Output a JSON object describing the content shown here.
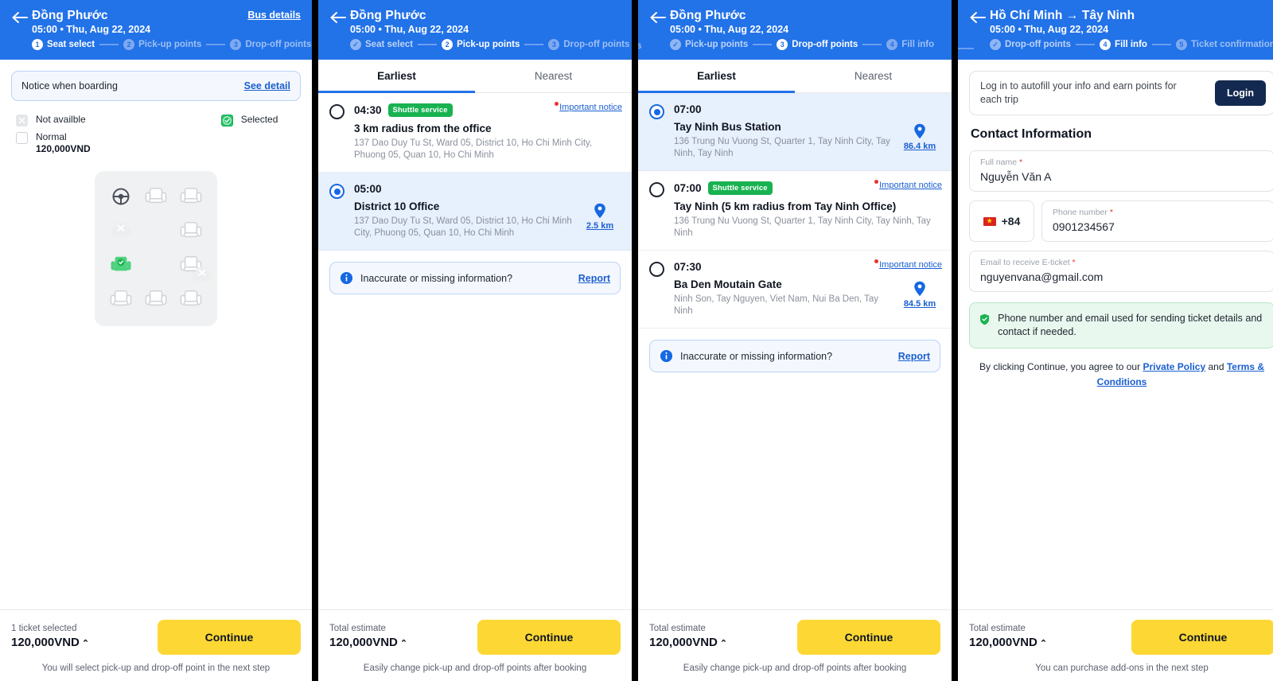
{
  "colors": {
    "header_blue": "#2272e8",
    "accent_yellow": "#fdd835",
    "link_blue": "#1a5fd0",
    "green": "#19b251",
    "selected_row": "#e7f0fd",
    "navy": "#13294f"
  },
  "panel1": {
    "header": {
      "title": "Đồng Phước",
      "subtitle": "05:00 • Thu, Aug 22, 2024",
      "right_link": "Bus details",
      "steps": [
        {
          "num": "1",
          "label": "Seat select",
          "state": "active"
        },
        {
          "num": "2",
          "label": "Pick-up points",
          "state": "todo"
        },
        {
          "num": "3",
          "label": "Drop-off points",
          "state": "todo"
        }
      ]
    },
    "notice": {
      "text": "Notice when boarding",
      "link": "See detail"
    },
    "legend": [
      {
        "key": "not_available",
        "label": "Not availble",
        "price": ""
      },
      {
        "key": "selected",
        "label": "Selected",
        "price": ""
      },
      {
        "key": "normal",
        "label": "Normal",
        "price": "120,000VND"
      }
    ],
    "seatmap": {
      "rows": [
        [
          "steering",
          "seat",
          "seat",
          "unavailable"
        ],
        [
          "unavailable",
          "empty",
          "seat",
          "empty"
        ],
        [
          "selected",
          "empty",
          "seat",
          "empty"
        ],
        [
          "seat",
          "seat",
          "seat",
          "empty"
        ]
      ]
    },
    "footer": {
      "label": "1 ticket selected",
      "price": "120,000VND",
      "caret": "⌃",
      "button": "Continue",
      "note": "You will select pick-up and drop-off point in the next step"
    }
  },
  "panel2": {
    "header": {
      "title": "Đồng Phước",
      "subtitle": "05:00 • Thu, Aug 22, 2024",
      "steps": [
        {
          "num": "✓",
          "label": "Seat select",
          "state": "done"
        },
        {
          "num": "2",
          "label": "Pick-up points",
          "state": "active"
        },
        {
          "num": "3",
          "label": "Drop-off points",
          "state": "todo"
        }
      ]
    },
    "tabs": [
      {
        "label": "Earliest",
        "active": true
      },
      {
        "label": "Nearest",
        "active": false
      }
    ],
    "points": [
      {
        "time": "04:30",
        "badge": "Shuttle service",
        "name": "3 km radius from the office",
        "address": "137 Dao Duy Tu St, Ward 05, District 10, Ho Chi Minh City, Phuong 05, Quan 10, Ho Chi Minh",
        "notice": "Important notice",
        "distance": "",
        "selected": false
      },
      {
        "time": "05:00",
        "badge": "",
        "name": "District 10 Office",
        "address": "137 Dao Duy Tu St, Ward 05, District 10, Ho Chi Minh City, Phuong 05, Quan 10, Ho Chi Minh",
        "notice": "",
        "distance": "2.5 km",
        "selected": true
      }
    ],
    "report": {
      "text": "Inaccurate or missing information?",
      "link": "Report"
    },
    "footer": {
      "label": "Total estimate",
      "price": "120,000VND",
      "caret": "⌃",
      "button": "Continue",
      "note": "Easily change pick-up and drop-off points after booking"
    }
  },
  "panel3": {
    "header": {
      "title": "Đồng Phước",
      "subtitle": "05:00 • Thu, Aug 22, 2024",
      "overflow_fragment": "s",
      "steps": [
        {
          "num": "✓",
          "label": "Pick-up points",
          "state": "done"
        },
        {
          "num": "3",
          "label": "Drop-off points",
          "state": "active"
        },
        {
          "num": "4",
          "label": "Fill info",
          "state": "todo"
        }
      ]
    },
    "tabs": [
      {
        "label": "Earliest",
        "active": true
      },
      {
        "label": "Nearest",
        "active": false
      }
    ],
    "points": [
      {
        "time": "07:00",
        "badge": "",
        "name": "Tay Ninh Bus Station",
        "address": "136 Trung Nu Vuong St, Quarter 1, Tay Ninh City, Tay Ninh, Tay Ninh",
        "notice": "",
        "distance": "86.4 km",
        "selected": true
      },
      {
        "time": "07:00",
        "badge": "Shuttle service",
        "name": "Tay Ninh (5 km radius from Tay Ninh Office)",
        "address": "136 Trung Nu Vuong St, Quarter 1, Tay Ninh City, Tay Ninh, Tay Ninh",
        "notice": "Important notice",
        "distance": "",
        "selected": false
      },
      {
        "time": "07:30",
        "badge": "",
        "name": "Ba Den Moutain Gate",
        "address": "Ninh Son, Tay Nguyen, Viet Nam, Nui Ba Den, Tay Ninh",
        "notice": "Important notice",
        "distance": "84.5 km",
        "selected": false
      }
    ],
    "report": {
      "text": "Inaccurate or missing information?",
      "link": "Report"
    },
    "footer": {
      "label": "Total estimate",
      "price": "120,000VND",
      "caret": "⌃",
      "button": "Continue",
      "note": "Easily change pick-up and drop-off points after booking"
    }
  },
  "panel4": {
    "header": {
      "title": "Hồ Chí Minh → Tây Ninh",
      "subtitle": "05:00 • Thu, Aug 22, 2024",
      "steps": [
        {
          "num": "✓",
          "label": "Drop-off points",
          "state": "done"
        },
        {
          "num": "4",
          "label": "Fill info",
          "state": "active"
        },
        {
          "num": "5",
          "label": "Ticket confirmation",
          "state": "todo"
        }
      ]
    },
    "login": {
      "text": "Log in to autofill your info and earn points for each trip",
      "button": "Login"
    },
    "section_title": "Contact Information",
    "fields": {
      "full_name": {
        "label": "Full name",
        "required": "*",
        "value": "Nguyễn Văn A"
      },
      "country_code": {
        "value": "+84",
        "flag": "vietnam-flag"
      },
      "phone": {
        "label": "Phone number",
        "required": "*",
        "value": "0901234567"
      },
      "email": {
        "label": "Email to receive E-ticket",
        "required": "*",
        "value": "nguyenvana@gmail.com"
      }
    },
    "green_note": "Phone number and email used for sending ticket details and contact if needed.",
    "terms": {
      "prefix": "By clicking Continue, you agree to our ",
      "link1": "Private Policy",
      "middle": " and ",
      "link2": "Terms & Conditions"
    },
    "footer": {
      "label": "Total estimate",
      "price": "120,000VND",
      "caret": "⌃",
      "button": "Continue",
      "note": "You can purchase add-ons in the next step"
    }
  }
}
